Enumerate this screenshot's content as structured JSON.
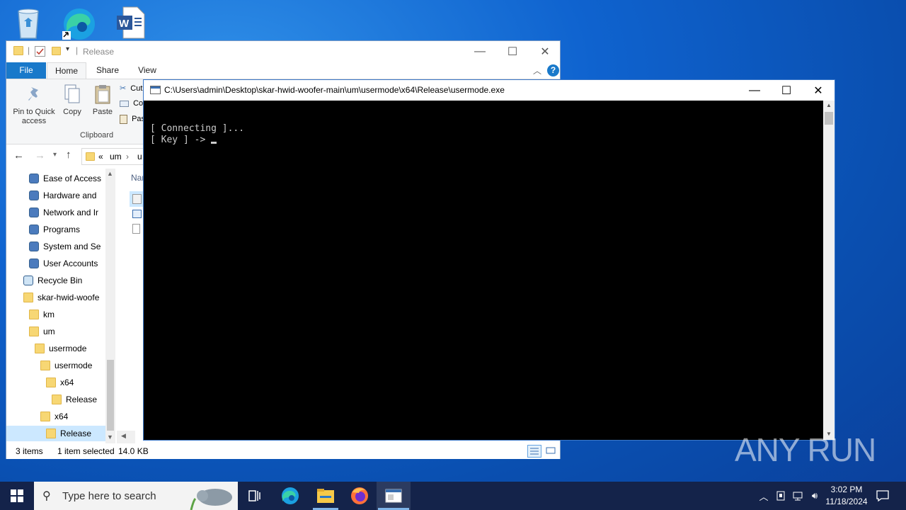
{
  "desktop": {
    "icons": [
      "recycle-bin-icon",
      "edge-icon",
      "word-document-icon"
    ]
  },
  "explorer": {
    "title": "Release",
    "tabs": [
      "File",
      "Home",
      "Share",
      "View"
    ],
    "ribbon": {
      "pin_label": "Pin to Quick access",
      "copy_label": "Copy",
      "paste_label": "Paste",
      "cut_label": "Cut",
      "copy_path_label": "Co",
      "paste_shortcut_label": "Pas",
      "group_label": "Clipboard"
    },
    "address": {
      "prefix": "«",
      "crumb1": "um",
      "crumb2": "u"
    },
    "column_header": "Nar",
    "nav_items": [
      {
        "label": "Ease of Access",
        "icon": "ease-of-access-icon"
      },
      {
        "label": "Hardware and",
        "icon": "hardware-icon"
      },
      {
        "label": "Network and Ir",
        "icon": "network-icon"
      },
      {
        "label": "Programs",
        "icon": "programs-icon"
      },
      {
        "label": "System and Se",
        "icon": "system-icon"
      },
      {
        "label": "User Accounts",
        "icon": "user-accounts-icon"
      },
      {
        "label": "Recycle Bin",
        "icon": "recycle-bin-icon"
      },
      {
        "label": "skar-hwid-woofe",
        "icon": "folder-icon"
      },
      {
        "label": "km",
        "icon": "folder-icon"
      },
      {
        "label": "um",
        "icon": "folder-icon"
      },
      {
        "label": "usermode",
        "icon": "folder-icon"
      },
      {
        "label": "usermode",
        "icon": "folder-icon"
      },
      {
        "label": "x64",
        "icon": "folder-icon"
      },
      {
        "label": "Release",
        "icon": "folder-icon"
      },
      {
        "label": "x64",
        "icon": "folder-icon"
      },
      {
        "label": "Release",
        "icon": "folder-icon"
      }
    ],
    "status": {
      "items": "3 items",
      "selected": "1 item selected",
      "size": "14.0 KB"
    }
  },
  "console": {
    "title": "C:\\Users\\admin\\Desktop\\skar-hwid-woofer-main\\um\\usermode\\x64\\Release\\usermode.exe",
    "lines": [
      "[ Connecting ]...",
      "[ Key ] -> "
    ]
  },
  "taskbar": {
    "search_placeholder": "Type here to search",
    "time": "3:02 PM",
    "date": "11/18/2024"
  },
  "watermark": "ANY RUN",
  "colors": {
    "accent": "#0078d7",
    "file_tab": "#1979ca",
    "taskbar": "#14234a",
    "console_bg": "#000000"
  }
}
